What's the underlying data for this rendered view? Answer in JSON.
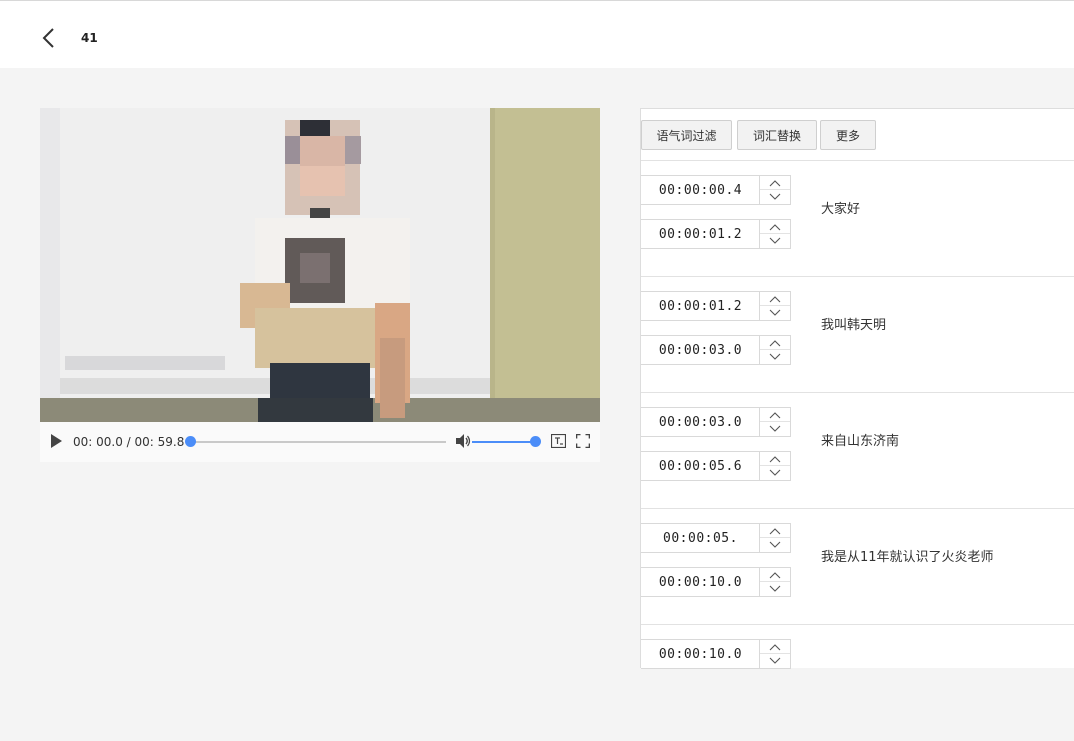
{
  "header": {
    "title": "41",
    "back_icon": "chevron-left-icon"
  },
  "player": {
    "time_display": "00: 00.0 / 00: 59.8",
    "progress_fraction": 0.0,
    "volume_fraction": 1.0,
    "accent_color": "#4b8df8"
  },
  "toolbar": {
    "filter_label": "语气词过滤",
    "replace_label": "词汇替换",
    "more_label": "更多"
  },
  "subtitles": [
    {
      "start": "00:00:00.4",
      "end": "00:00:01.2",
      "text": "大家好"
    },
    {
      "start": "00:00:01.2",
      "end": "00:00:03.0",
      "text": "我叫韩天明"
    },
    {
      "start": "00:00:03.0",
      "end": "00:00:05.6",
      "text": "来自山东济南"
    },
    {
      "start": "00:00:05.",
      "end": "00:00:10.0",
      "text": "我是从11年就认识了火炎老师"
    },
    {
      "start": "00:00:10.0",
      "end": "",
      "text": ""
    }
  ]
}
